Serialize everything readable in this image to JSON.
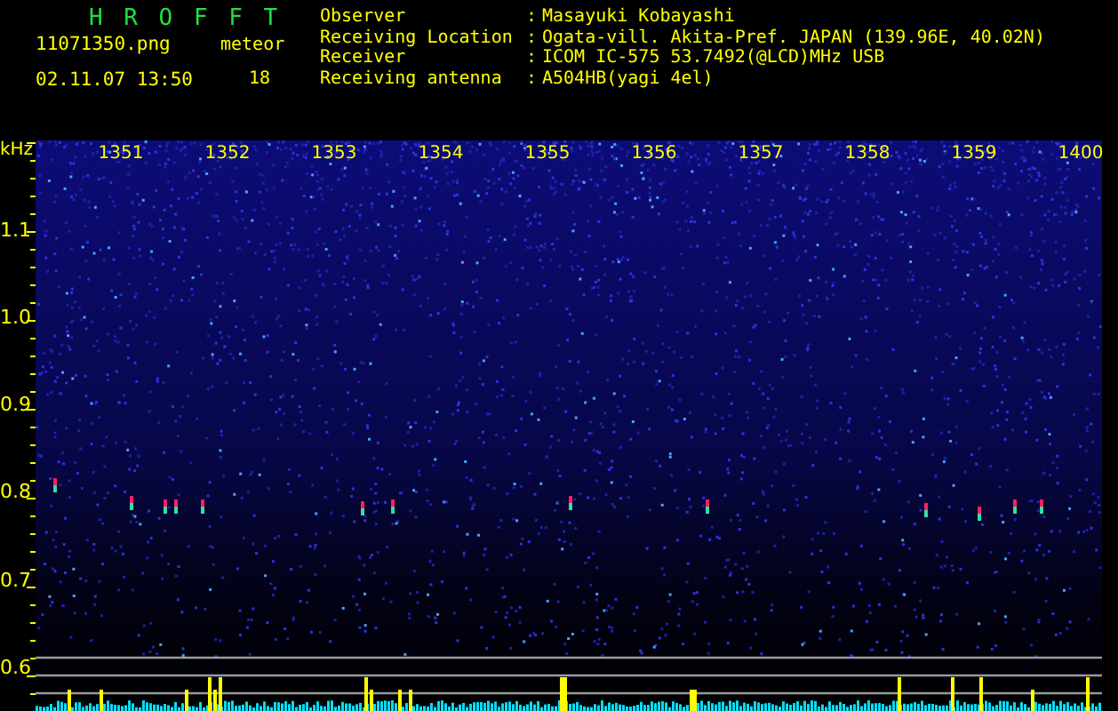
{
  "app_title": "H R O F F T",
  "file_name": "11071350.png",
  "timestamp": "02.11.07 13:50",
  "meteor_label": "meteor",
  "meteor_count": "18",
  "info": [
    {
      "label": "Observer",
      "separator": ":",
      "value": "Masayuki Kobayashi"
    },
    {
      "label": "Receiving Location",
      "separator": ":",
      "value": "Ogata-vill. Akita-Pref. JAPAN (139.96E, 40.02N)"
    },
    {
      "label": "Receiver",
      "separator": ":",
      "value": "ICOM IC-575 53.7492(@LCD)MHz USB"
    },
    {
      "label": "Receiving antenna",
      "separator": ":",
      "value": "A504HB(yagi 4el)"
    }
  ],
  "frequency_axis": {
    "unit": "kHz",
    "labels": [
      "1.1",
      "1.0",
      "0.9",
      "0.8",
      "0.7",
      "0.6"
    ]
  },
  "time_labels": [
    "1351",
    "1352",
    "1353",
    "1354",
    "1355",
    "1356",
    "1357",
    "1358",
    "1359",
    "1400"
  ]
}
